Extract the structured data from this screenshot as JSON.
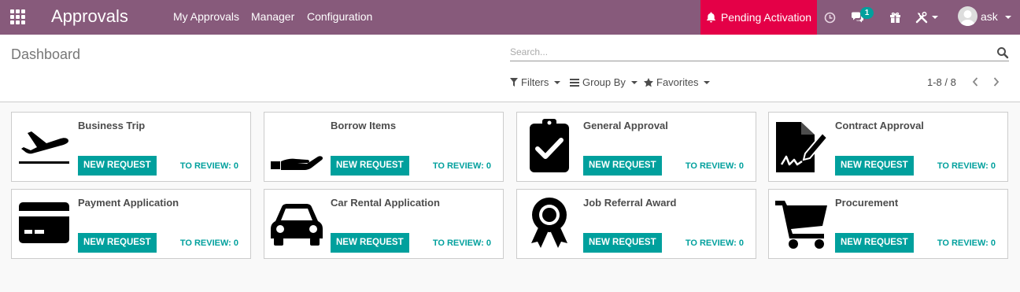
{
  "navbar": {
    "brand": "Approvals",
    "menu": [
      "My Approvals",
      "Manager",
      "Configuration"
    ],
    "pending_label": "Pending Activation",
    "messages_count": "1",
    "user_name": "ask"
  },
  "control_panel": {
    "breadcrumb": "Dashboard",
    "search_placeholder": "Search...",
    "filters_label": "Filters",
    "groupby_label": "Group By",
    "favorites_label": "Favorites",
    "pager": "1-8 / 8"
  },
  "cards": [
    {
      "title": "Business Trip",
      "icon": "airplane-icon",
      "button": "NEW REQUEST",
      "review": "TO REVIEW: 0"
    },
    {
      "title": "Borrow Items",
      "icon": "hand-icon",
      "button": "NEW REQUEST",
      "review": "TO REVIEW: 0"
    },
    {
      "title": "General Approval",
      "icon": "clipboard-check-icon",
      "button": "NEW REQUEST",
      "review": "TO REVIEW: 0"
    },
    {
      "title": "Contract Approval",
      "icon": "signed-document-icon",
      "button": "NEW REQUEST",
      "review": "TO REVIEW: 0"
    },
    {
      "title": "Payment Application",
      "icon": "credit-card-icon",
      "button": "NEW REQUEST",
      "review": "TO REVIEW: 0"
    },
    {
      "title": "Car Rental Application",
      "icon": "car-icon",
      "button": "NEW REQUEST",
      "review": "TO REVIEW: 0"
    },
    {
      "title": "Job Referral Award",
      "icon": "award-ribbon-icon",
      "button": "NEW REQUEST",
      "review": "TO REVIEW: 0"
    },
    {
      "title": "Procurement",
      "icon": "shopping-cart-icon",
      "button": "NEW REQUEST",
      "review": "TO REVIEW: 0"
    }
  ],
  "colors": {
    "navbar": "#875a7b",
    "accent": "#00a09d",
    "pending": "#e40047"
  }
}
